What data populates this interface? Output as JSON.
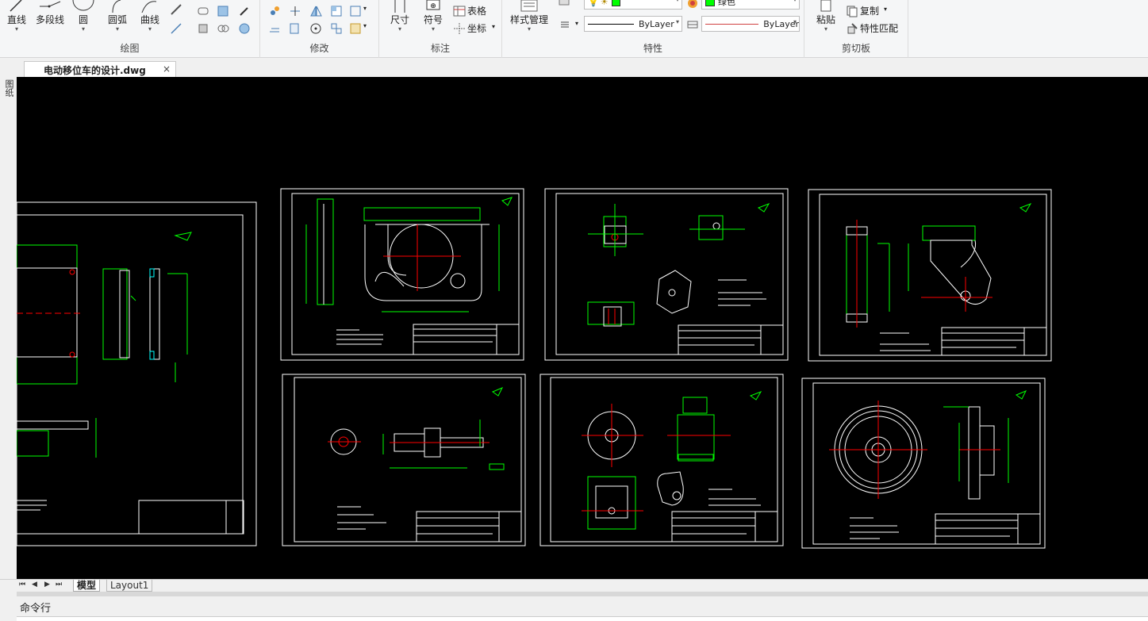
{
  "ribbon": {
    "draw": {
      "title": "绘图",
      "line": "直线",
      "polyline": "多段线",
      "circle": "圆",
      "arc": "圆弧",
      "curve": "曲线"
    },
    "modify": {
      "title": "修改"
    },
    "annotate": {
      "title": "标注",
      "dimension": "尺寸",
      "symbol": "符号",
      "table": "表格",
      "coordinate": "坐标"
    },
    "properties": {
      "title": "特性",
      "style_manager": "样式管理",
      "linetype": "ByLayer",
      "lineweight": "ByLayer",
      "color_name": "绿色"
    },
    "clipboard": {
      "title": "剪切板",
      "paste": "粘贴",
      "copy": "复制",
      "match": "特性匹配"
    }
  },
  "document": {
    "tab_title": "电动移位车的设计.dwg",
    "close": "×"
  },
  "left_strip": {
    "label": "图纸"
  },
  "layout_tabs": {
    "model": "模型",
    "layout1": "Layout1"
  },
  "command": {
    "label": "命令行"
  },
  "colors": {
    "canvas": "#000000",
    "border": "#ffffff",
    "geometry": "#00ff00",
    "center": "#ff0000",
    "accent": "#00ffff"
  }
}
